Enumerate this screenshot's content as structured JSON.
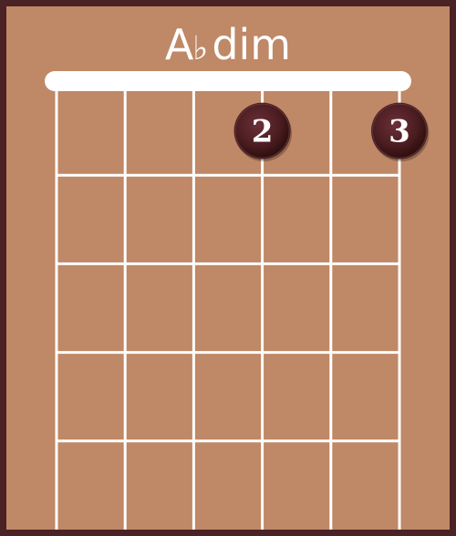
{
  "chord": {
    "root": "A",
    "accidental": "♭",
    "quality": "dim"
  },
  "diagram": {
    "strings": 6,
    "frets": 5,
    "nut": true,
    "fingers": [
      {
        "string": 4,
        "fret": 1,
        "label": "2"
      },
      {
        "string": 6,
        "fret": 1,
        "label": "3"
      }
    ]
  },
  "colors": {
    "background": "#bf8866",
    "frame": "#4a2326",
    "lines": "#ffffff",
    "finger_dot": "#4a1c20",
    "title_text": "#ffffff"
  }
}
